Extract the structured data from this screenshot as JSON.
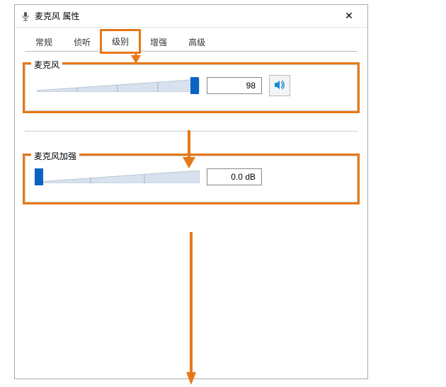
{
  "window": {
    "title": "麦克风 属性",
    "close_label": "✕"
  },
  "tabs": {
    "general": "常规",
    "listen": "侦听",
    "levels": "级别",
    "enhance": "增强",
    "advanced": "高级"
  },
  "mic_group": {
    "legend": "麦克风",
    "value_display": "98",
    "value_numeric": 98,
    "slider_percent": 98
  },
  "boost_group": {
    "legend": "麦克风加强",
    "value_display": "0.0 dB",
    "value_numeric": 0.0,
    "slider_percent": 0
  },
  "colors": {
    "highlight": "#e77817",
    "slider_thumb": "#0a63c4",
    "track_fill": "#d7e2ee"
  }
}
